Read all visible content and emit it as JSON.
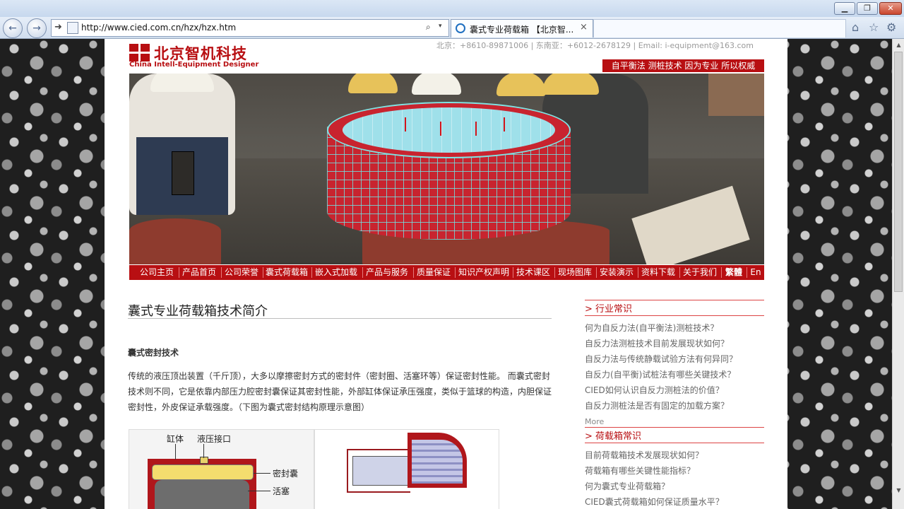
{
  "browser": {
    "url": "http://www.cied.com.cn/hzx/hzx.htm",
    "tab_title": "囊式专业荷载箱 【北京智...",
    "tab_close": "×",
    "window_buttons": {
      "minimize": "▁",
      "maximize": "❐",
      "close": "✕"
    },
    "toolbar_icons": [
      "home-icon",
      "star-icon",
      "gear-icon"
    ],
    "nav_icons": {
      "back": "←",
      "forward": "→",
      "go": "➜",
      "search": "⌕",
      "dropdown": "▾",
      "home": "⌂",
      "favorites": "☆",
      "tools": "⚙"
    }
  },
  "header": {
    "logo_cn": "北京智机科技",
    "logo_en": "China Intell-Equipment Designer",
    "contact": "北京：+8610-89871006 | 东南亚：+6012-2678129 | Email: i-equipment@163.com",
    "slogan": "自平衡法 测桩技术 因为专业 所以权威"
  },
  "menu": [
    "公司主页",
    "产品首页",
    "公司荣誉",
    "囊式荷载箱",
    "嵌入式加载",
    "产品与服务",
    "质量保证",
    "知识产权声明",
    "技术课区",
    "现场图库",
    "安装演示",
    "资料下载",
    "关于我们",
    "繁體",
    "En"
  ],
  "article": {
    "title": "囊式专业荷载箱技术简介",
    "subheading": "囊式密封技术",
    "paragraph": "传统的液压顶出装置（千斤顶），大多以摩擦密封方式的密封件（密封圈、活塞环等）保证密封性能。 而囊式密封技术则不同，它是依靠内部压力腔密封囊保证其密封性能，外部缸体保证承压强度，类似于篮球的构造，内胆保证密封性，外皮保证承载强度。（下图为囊式密封结构原理示意图）",
    "figure_labels": {
      "cylinder": "缸体",
      "port": "液压接口",
      "seal_bag": "密封囊",
      "piston": "活塞"
    }
  },
  "sidebar": {
    "sections": [
      {
        "title": "> 行业常识",
        "links": [
          "何为自反力法(自平衡法)测桩技术？",
          "自反力法测桩技术目前发展现状如何？",
          "自反力法与传统静载试验方法有何异同？",
          "自反力(自平衡)试桩法有哪些关键技术？",
          "CIED如何认识自反力测桩法的价值？",
          "自反力测桩法是否有固定的加载方案？"
        ],
        "more": "More ..."
      },
      {
        "title": "> 荷载箱常识",
        "links": [
          "目前荷载箱技术发展现状如何？",
          "荷载箱有哪些关键性能指标？",
          "何为囊式专业荷载箱？",
          "CIED囊式荷载箱如何保证质量水平？"
        ]
      }
    ]
  },
  "colors": {
    "brand_red": "#b80f12",
    "link_gray": "#666666",
    "page_bg": "#ffffff"
  }
}
